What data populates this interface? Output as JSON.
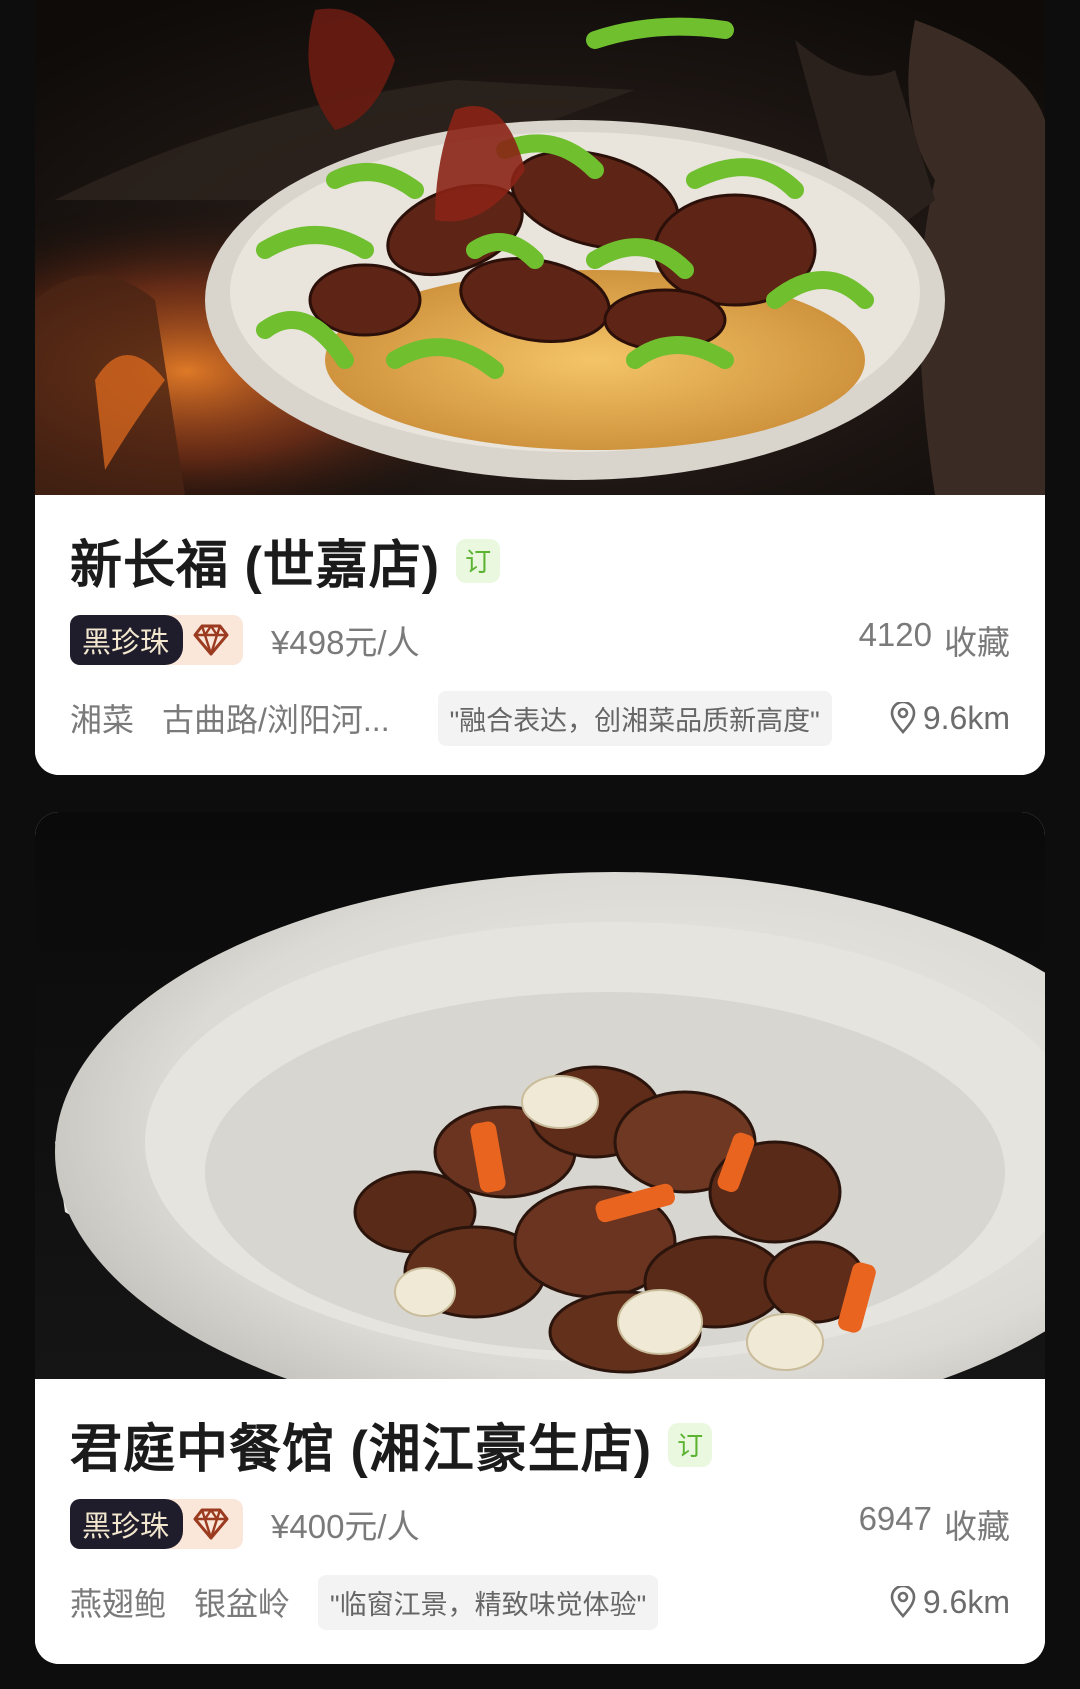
{
  "restaurants": [
    {
      "name": "新长福 (世嘉店)",
      "book_badge": "订",
      "rank_badge": "黑珍珠",
      "rank_icon": "diamond-icon",
      "price": "¥498元/人",
      "favorites_count": "4120",
      "favorites_label": "收藏",
      "cuisine": "湘菜",
      "area": "古曲路/浏阳河...",
      "quote": "\"融合表达，创湘菜品质新高度\"",
      "distance": "9.6km"
    },
    {
      "name": "君庭中餐馆 (湘江豪生店)",
      "book_badge": "订",
      "rank_badge": "黑珍珠",
      "rank_icon": "diamond-icon",
      "price": "¥400元/人",
      "favorites_count": "6947",
      "favorites_label": "收藏",
      "cuisine": "燕翅鲍",
      "area": "银盆岭",
      "quote": "\"临窗江景，精致味觉体验\"",
      "distance": "9.6km"
    }
  ],
  "colors": {
    "page_bg": "#0d0d0d",
    "book_tag_text": "#5bb331",
    "book_tag_bg": "#eaf8df",
    "pearl_bg": "#1f1d2b",
    "pearl_text": "#f2e6cf",
    "diamond_bg": "#fbe6da",
    "diamond_stroke": "#9b3b1f"
  }
}
